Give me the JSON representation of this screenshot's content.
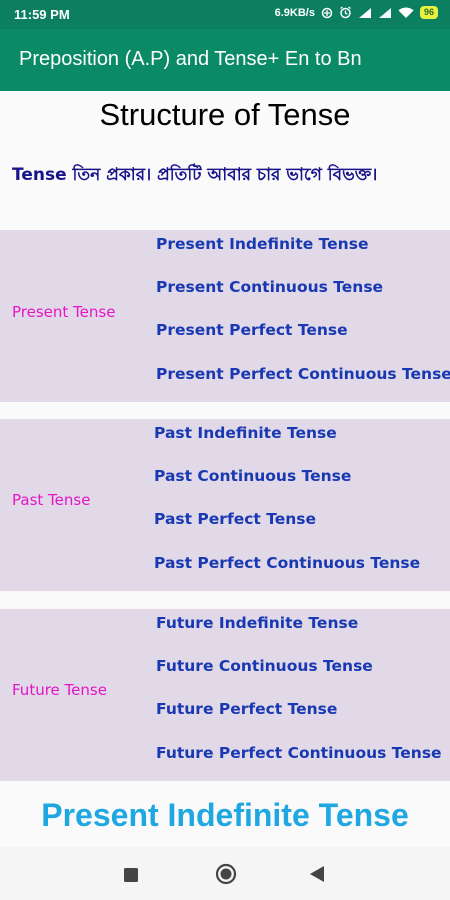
{
  "status_bar": {
    "time": "11:59 PM",
    "net_speed": "6.9KB/s",
    "battery": "96",
    "icons": [
      "data-saver-icon",
      "alarm-icon",
      "signal-icon",
      "signal-icon",
      "wifi-icon",
      "battery-icon"
    ]
  },
  "app_bar": {
    "title": "Preposition (A.P) and Tense+ En to Bn"
  },
  "page": {
    "title": "Structure of Tense",
    "intro": "Tense তিন প্রকার। প্রতিটি আবার চার ভাগে বিভক্ত।",
    "groups": [
      {
        "label": "Present Tense",
        "items": [
          "Present Indefinite Tense",
          "Present Continuous Tense",
          "Present Perfect Tense",
          "Present Perfect Continuous Tense"
        ]
      },
      {
        "label": "Past Tense",
        "items": [
          "Past Indefinite Tense",
          "Past Continuous Tense",
          "Past Perfect Tense",
          "Past Perfect Continuous Tense"
        ]
      },
      {
        "label": "Future Tense",
        "items": [
          "Future Indefinite Tense",
          "Future Continuous Tense",
          "Future Perfect Tense",
          "Future Perfect Continuous Tense"
        ]
      }
    ],
    "next_heading": "Present Indefinite Tense"
  },
  "nav_bar": {
    "buttons": [
      "recents-square-icon",
      "home-circle-icon",
      "back-triangle-icon"
    ]
  },
  "colors": {
    "app_bar": "#0b8a66",
    "group_bg": "#e2d9e8",
    "group_label": "#e415c6",
    "item_text": "#1939b3",
    "heading_blue": "#1ea7e0"
  }
}
